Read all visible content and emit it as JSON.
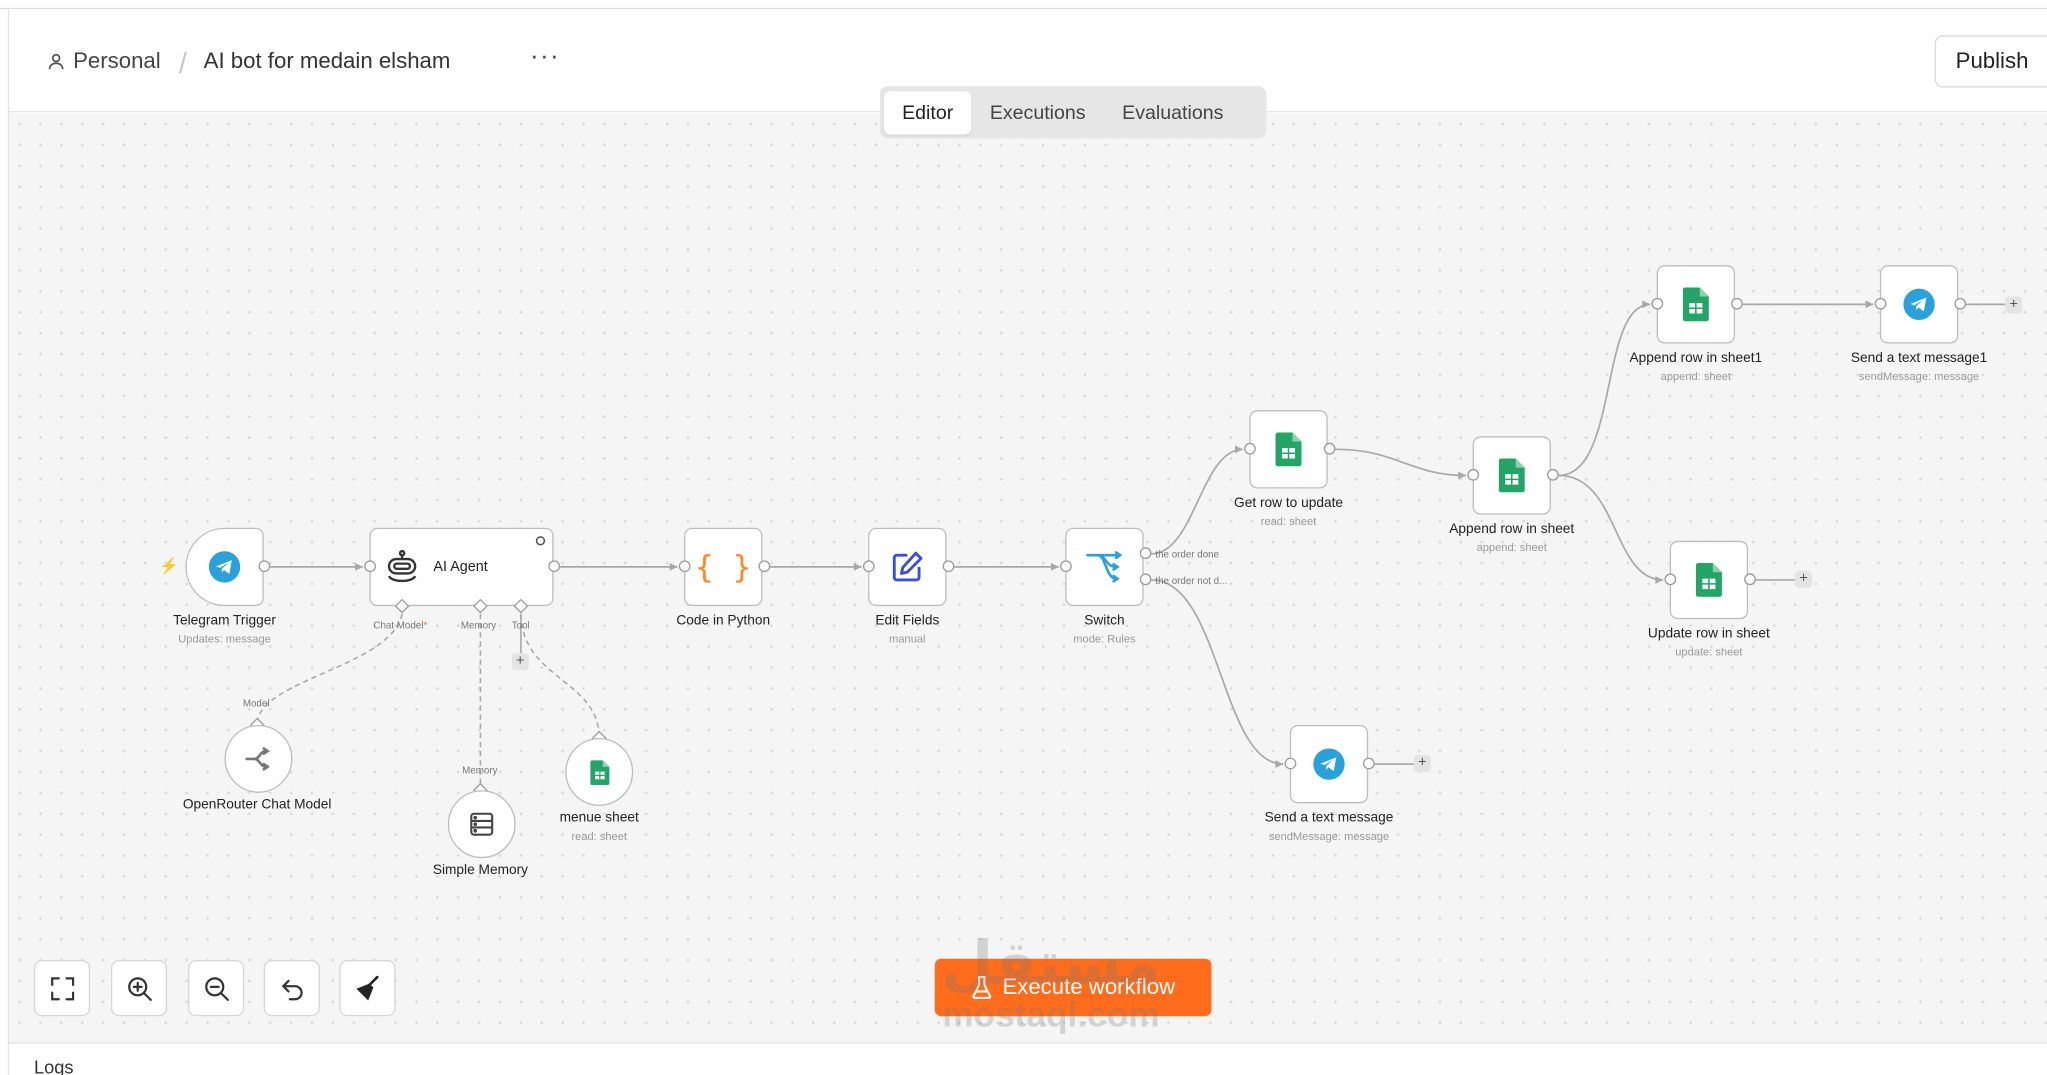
{
  "header": {
    "breadcrumb_personal": "Personal",
    "breadcrumb_separator": "/",
    "workflow_name": "AI bot for medain elsham",
    "more_label": "···",
    "publish_label": "Publish"
  },
  "tabs": [
    "Editor",
    "Executions",
    "Evaluations"
  ],
  "nodes": {
    "telegram_trigger": {
      "title": "Telegram Trigger",
      "subtitle": "Updates: message"
    },
    "ai_agent": {
      "title": "AI Agent",
      "port_chat_model": "Chat Model",
      "port_chat_model_required": "*",
      "port_memory": "Memory",
      "port_tool": "Tool"
    },
    "code_python": {
      "title": "Code in Python"
    },
    "edit_fields": {
      "title": "Edit Fields",
      "subtitle": "manual"
    },
    "switch": {
      "title": "Switch",
      "subtitle": "mode: Rules",
      "out1": "the order done",
      "out2": "the order not d..."
    },
    "get_row": {
      "title": "Get row to update",
      "subtitle": "read: sheet"
    },
    "append_row": {
      "title": "Append row in sheet",
      "subtitle": "append: sheet"
    },
    "append_row1": {
      "title": "Append row in sheet1",
      "subtitle": "append: sheet"
    },
    "send_msg1": {
      "title": "Send a text message1",
      "subtitle": "sendMessage: message"
    },
    "update_row": {
      "title": "Update row in sheet",
      "subtitle": "update: sheet"
    },
    "send_msg": {
      "title": "Send a text message",
      "subtitle": "sendMessage: message"
    },
    "openrouter": {
      "title": "OpenRouter Chat Model",
      "port": "Model"
    },
    "memory": {
      "title": "Simple Memory",
      "port": "Memory"
    },
    "menue_sheet": {
      "title": "menue sheet",
      "subtitle": "read: sheet"
    }
  },
  "controls": {
    "execute_label": "Execute workflow",
    "plus": "+"
  },
  "watermark": {
    "arabic": "مستقل",
    "latin": "mostaql.com"
  },
  "logs_label": "Logs",
  "colors": {
    "accent": "#ff6d1c",
    "sheets_green": "#23a566",
    "telegram_blue": "#2aa1da",
    "edit_blue": "#3a4ed7"
  }
}
